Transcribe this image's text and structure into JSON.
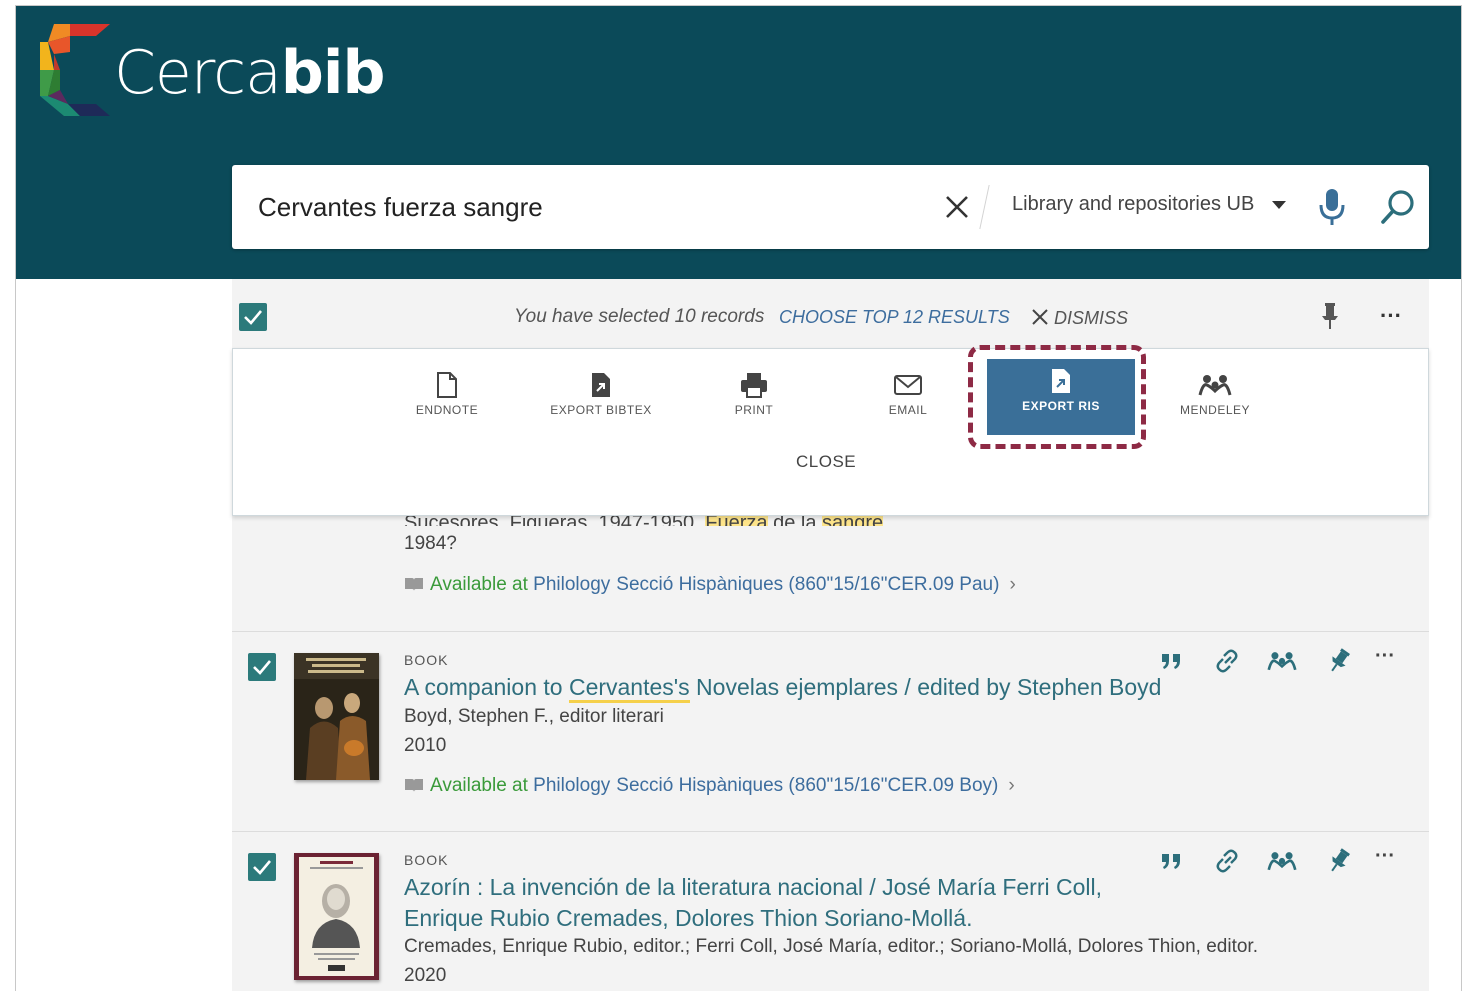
{
  "brand": {
    "name_light": "Cerca",
    "name_bold": "bib"
  },
  "search": {
    "query": "Cervantes fuerza sangre",
    "scope": "Library and repositories UB"
  },
  "selection": {
    "text": "You have selected 10 records",
    "choose_top": "CHOOSE TOP 12 RESULTS",
    "dismiss": "DISMISS"
  },
  "actions": [
    {
      "label": "ENDNOTE",
      "icon": "document-icon"
    },
    {
      "label": "EXPORT BIBTEX",
      "icon": "export-file-icon"
    },
    {
      "label": "PRINT",
      "icon": "printer-icon"
    },
    {
      "label": "EMAIL",
      "icon": "envelope-icon"
    },
    {
      "label": "EXPORT RIS",
      "icon": "export-file-icon",
      "active": true
    },
    {
      "label": "MENDELEY",
      "icon": "mendeley-icon"
    }
  ],
  "close_label": "CLOSE",
  "partial_record": {
    "year": "1984?",
    "avail_prefix": "Available at ",
    "library": "Philology",
    "location": "Secció Hispàniques (860\"15/16\"CER.09 Pau)"
  },
  "records": [
    {
      "type": "BOOK",
      "title_pre": "A companion to ",
      "title_hl": "Cervantes's",
      "title_post": " Novelas ejemplares / edited by Stephen Boyd",
      "author": "Boyd, Stephen F., editor literari",
      "year": "2010",
      "avail_prefix": "Available at ",
      "library": "Philology",
      "location": "Secció Hispàniques (860\"15/16\"CER.09 Boy)"
    },
    {
      "type": "BOOK",
      "title_line1": "Azorín : La invención de la literatura nacional / José María Ferri Coll,",
      "title_line2": "Enrique Rubio Cremades, Dolores Thion Soriano-Mollá.",
      "author": "Cremades, Enrique Rubio, editor.; Ferri Coll, José María, editor.; Soriano-Mollá, Dolores Thion, editor.",
      "year": "2020"
    }
  ],
  "colors": {
    "header": "#0b4a59",
    "accent": "#3a6f98",
    "highlight": "#8e2a45",
    "check": "#2c7a7b"
  }
}
